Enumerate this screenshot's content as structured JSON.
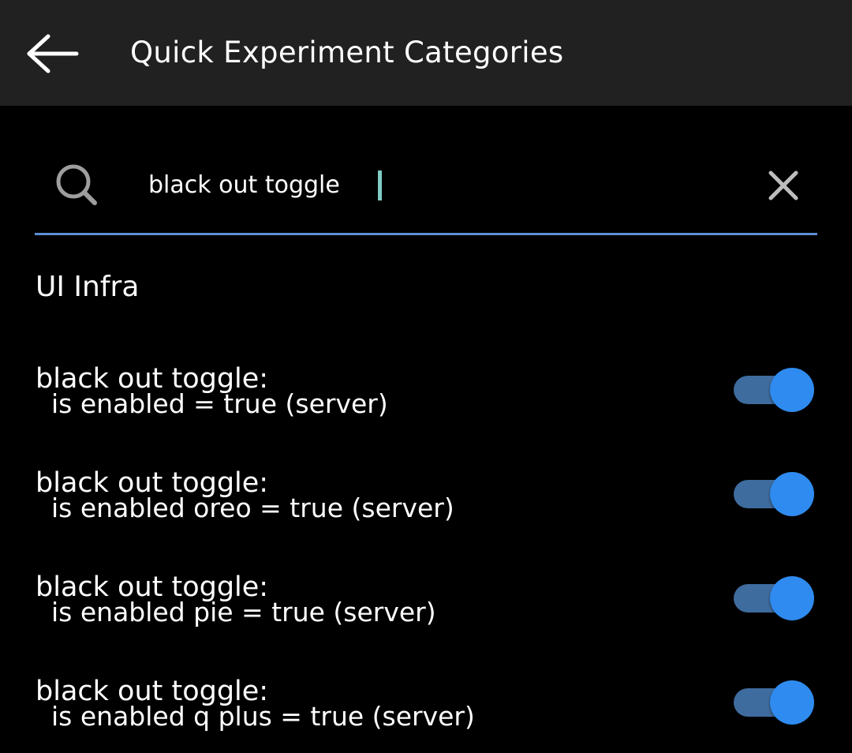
{
  "toolbar": {
    "title": "Quick Experiment Categories",
    "back_icon": "arrow-left-icon"
  },
  "search": {
    "value": "black out toggle",
    "search_icon": "search-icon",
    "clear_icon": "close-icon",
    "underline_color": "#5c8fd6",
    "caret_color": "#80cbc4"
  },
  "category": {
    "name": "UI Infra"
  },
  "experiments": [
    {
      "title": "black out toggle:",
      "detail": "is enabled = true (server)",
      "enabled": true
    },
    {
      "title": "black out toggle:",
      "detail": "is enabled oreo = true (server)",
      "enabled": true
    },
    {
      "title": "black out toggle:",
      "detail": "is enabled pie = true (server)",
      "enabled": true
    },
    {
      "title": "black out toggle:",
      "detail": "is enabled q plus = true (server)",
      "enabled": true
    }
  ],
  "colors": {
    "toolbar_bg": "#212121",
    "background": "#000000",
    "switch_track_on": "#3f6c9e",
    "switch_thumb_on": "#2f8bef"
  }
}
